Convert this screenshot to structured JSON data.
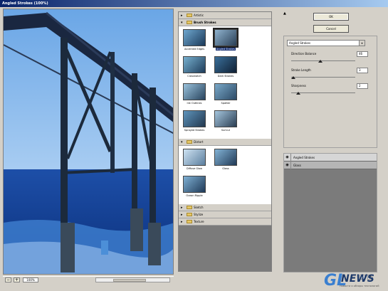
{
  "window": {
    "title": "Angled Strokes (100%)"
  },
  "preview": {
    "zoom": "100%"
  },
  "gallery": {
    "groups": [
      {
        "label": "Artistic",
        "expanded": false
      },
      {
        "label": "Brush Strokes",
        "expanded": true,
        "filters": [
          "Accented Edges",
          "Angled Strokes",
          "Crosshatch",
          "Dark Strokes",
          "Ink Outlines",
          "Spatter",
          "Sprayed Strokes",
          "Sumi-e"
        ],
        "selected": "Angled Strokes"
      },
      {
        "label": "Distort",
        "expanded": true,
        "filters": [
          "Diffuse Glow",
          "Glass",
          "Ocean Ripple"
        ]
      },
      {
        "label": "Sketch",
        "expanded": false
      },
      {
        "label": "Stylize",
        "expanded": false
      },
      {
        "label": "Texture",
        "expanded": false
      }
    ]
  },
  "buttons": {
    "ok": "OK",
    "cancel": "Cancel"
  },
  "settings": {
    "filter": "Angled Strokes",
    "direction_balance": {
      "label": "Direction Balance",
      "value": "46"
    },
    "stroke_length": {
      "label": "Stroke Length",
      "value": "3"
    },
    "sharpness": {
      "label": "Sharpness",
      "value": "2"
    }
  },
  "layers": [
    {
      "name": "Angled Strokes",
      "active": true
    },
    {
      "name": "Glass",
      "active": false
    }
  ],
  "logo": {
    "brand": "NEWS",
    "initials": "GL",
    "tagline": "Новости и обзоры технологий"
  },
  "colors": {
    "sky": "#4a8fd6",
    "sea": "#0f3a8c",
    "selection": "#0a246a",
    "panel": "#d4d0c8"
  }
}
